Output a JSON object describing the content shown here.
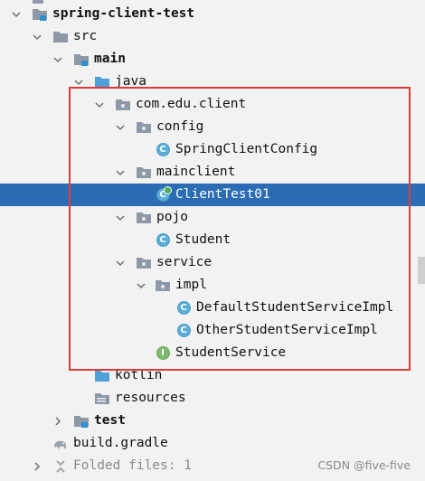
{
  "tree": {
    "project": "spring-client-test",
    "src": "src",
    "main": "main",
    "java": "java",
    "package": "com.edu.client",
    "config": "config",
    "spring_client_config": "SpringClientConfig",
    "mainclient": "mainclient",
    "client_test": "ClientTest01",
    "pojo": "pojo",
    "student": "Student",
    "service": "service",
    "impl": "impl",
    "default_impl": "DefaultStudentServiceImpl",
    "other_impl": "OtherStudentServiceImpl",
    "student_service": "StudentService",
    "kotlin": "kotlin",
    "resources": "resources",
    "test": "test",
    "build_gradle": "build.gradle",
    "folded_files": "Folded files: 1"
  },
  "icons": {
    "class_letter": "C",
    "interface_letter": "I"
  },
  "colors": {
    "selection": "#2b6cb5",
    "highlight_box": "#e03b3b",
    "class_icon": "#5aaed6",
    "interface_icon": "#7fb96f",
    "folder": "#8d99a6"
  },
  "watermark": "CSDN @five-five"
}
